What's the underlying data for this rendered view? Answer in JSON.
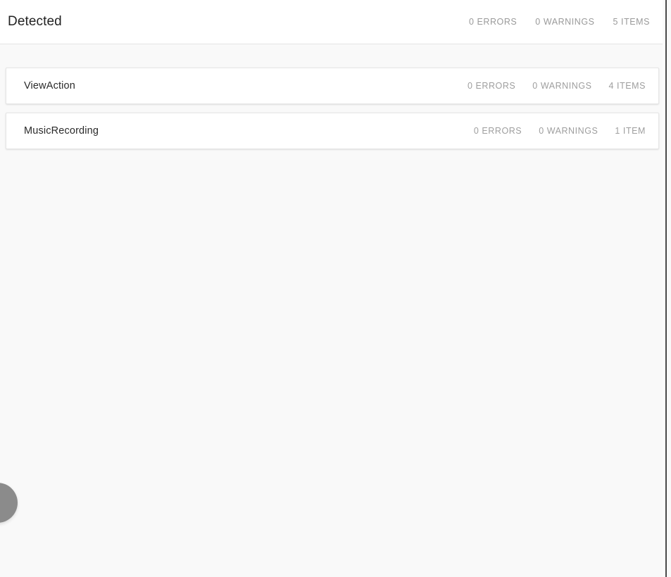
{
  "header": {
    "title": "Detected",
    "stats": [
      {
        "label": "0 ERRORS"
      },
      {
        "label": "0 WARNINGS"
      },
      {
        "label": "5 ITEMS"
      }
    ]
  },
  "cards": [
    {
      "title": "ViewAction",
      "stats": [
        {
          "label": "0 ERRORS"
        },
        {
          "label": "0 WARNINGS"
        },
        {
          "label": "4 ITEMS"
        }
      ]
    },
    {
      "title": "MusicRecording",
      "stats": [
        {
          "label": "0 ERRORS"
        },
        {
          "label": "0 WARNINGS"
        },
        {
          "label": "1 ITEM"
        }
      ]
    }
  ],
  "floating_handle": {
    "icon": "circle-handle-icon",
    "color": "#8b8b8b"
  },
  "colors": {
    "page_background": "#f9f9f9",
    "card_background": "#ffffff",
    "header_background": "#ffffff",
    "title_text": "#222222",
    "stat_text": "#9a9a9a",
    "border": "#e6e6e6"
  }
}
